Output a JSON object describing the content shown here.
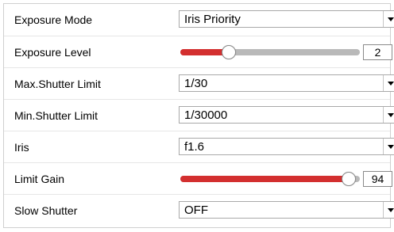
{
  "settings": [
    {
      "label": "Exposure Mode",
      "type": "select",
      "value": "Iris Priority"
    },
    {
      "label": "Exposure Level",
      "type": "slider",
      "value": "2",
      "fraction": 0.27
    },
    {
      "label": "Max.Shutter Limit",
      "type": "select",
      "value": "1/30"
    },
    {
      "label": "Min.Shutter Limit",
      "type": "select",
      "value": "1/30000"
    },
    {
      "label": "Iris",
      "type": "select",
      "value": "f1.6"
    },
    {
      "label": "Limit Gain",
      "type": "slider",
      "value": "94",
      "fraction": 0.94
    },
    {
      "label": "Slow Shutter",
      "type": "select",
      "value": "OFF"
    }
  ],
  "colors": {
    "slider_fill": "#d32f2f",
    "slider_track": "#b9b9b9"
  },
  "icons": {
    "dropdown": "chevron-down-icon"
  }
}
